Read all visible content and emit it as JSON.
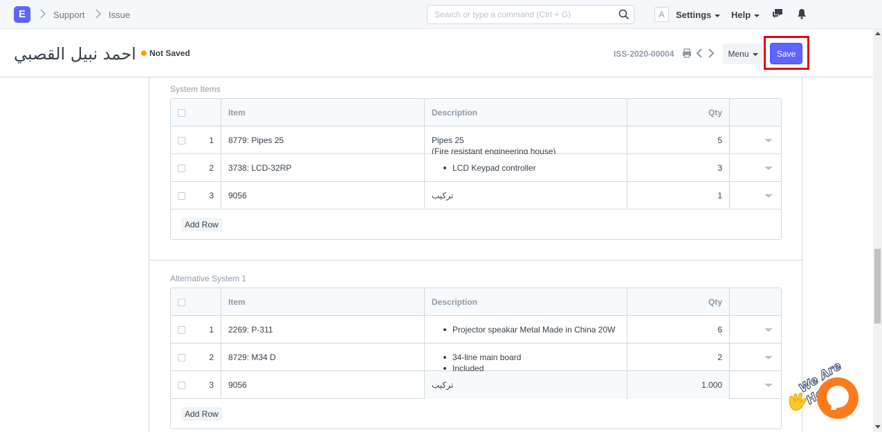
{
  "navbar": {
    "logo_letter": "E",
    "breadcrumbs": [
      "Support",
      "Issue"
    ],
    "search_placeholder": "Search or type a command (Ctrl + G)",
    "avatar_letter": "A",
    "settings_label": "Settings",
    "help_label": "Help"
  },
  "header": {
    "title": "احمد نبيل القصبي",
    "status": "Not Saved",
    "doc_id": "ISS-2020-00004",
    "menu_label": "Menu",
    "save_label": "Save"
  },
  "grid_headers": {
    "item": "Item",
    "description": "Description",
    "qty": "Qty"
  },
  "sections": [
    {
      "label": "System Items",
      "add_row_label": "Add Row",
      "rows": [
        {
          "idx": "1",
          "item": "8779: Pipes 25",
          "desc_lines": [
            "Pipes 25",
            "(Fire resistant engineering house)"
          ],
          "desc_type": "text",
          "qty": "5"
        },
        {
          "idx": "2",
          "item": "3738: LCD-32RP",
          "desc_lines": [
            "LCD Keypad controller"
          ],
          "desc_type": "bullets",
          "qty": "3"
        },
        {
          "idx": "3",
          "item": "9056",
          "desc_lines": [
            "تركيب"
          ],
          "desc_type": "text",
          "qty": "1"
        }
      ]
    },
    {
      "label": "Alternative System 1",
      "add_row_label": "Add Row",
      "rows": [
        {
          "idx": "1",
          "item": "2269: P-311",
          "desc_lines": [
            "Projector speakar Metal Made in China 20W"
          ],
          "desc_type": "bullets",
          "qty": "6"
        },
        {
          "idx": "2",
          "item": "8729: M34 D",
          "desc_lines": [
            "34-line main board",
            "Included"
          ],
          "desc_type": "bullets",
          "qty": "2"
        },
        {
          "idx": "3",
          "item": "9056",
          "desc_lines": [
            "تركيب"
          ],
          "desc_type": "text",
          "qty": "1.000"
        }
      ]
    }
  ],
  "chat_widget": {
    "label": "We Are Here!"
  },
  "colors": {
    "primary": "#5e64ff",
    "highlight": "#e0061a",
    "indicator": "#ffa00a",
    "chat": "#ff7a1a"
  }
}
